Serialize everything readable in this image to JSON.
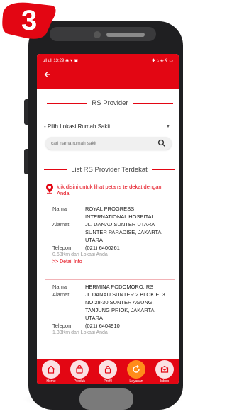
{
  "badge": {
    "number": "3"
  },
  "status": {
    "left": "ull ull 13:29 ◉ ♥ ▣",
    "right": "✱ ⌂ ◈ ⚲ ▭"
  },
  "header": {
    "back_icon": "arrow-left-icon"
  },
  "provider_heading": "RS Provider",
  "location_select": {
    "value": "- Pilih Lokasi Rumah Sakit"
  },
  "search": {
    "placeholder": "cari nama rumah sakit",
    "icon": "search-icon"
  },
  "list_heading": "List RS Provider Terdekat",
  "map_link": {
    "text": "klik disini untuk lihat peta rs terdekat dengan Anda",
    "icon": "location-pin-icon"
  },
  "labels": {
    "name": "Nama",
    "address": "Alamat",
    "phone": "Telepon"
  },
  "providers": [
    {
      "name": "ROYAL PROGRESS INTERNATIONAL HOSPITAL",
      "address": "JL. DANAU SUNTER UTARA SUNTER PARADISE, JAKARTA UTARA",
      "phone": "(021) 6400261",
      "distance": "0.68Km dari Lokasi Anda",
      "detail": ">> Detail Info"
    },
    {
      "name": "HERMINA PODOMORO, RS",
      "address": "JL DANAU SUNTER 2 BLOK E, 3 NO 28-30 SUNTER AGUNG, TANJUNG PRIOK, JAKARTA UTARA",
      "phone": "(021) 6404910",
      "distance": "1.33Km dari Lokasi Anda"
    }
  ],
  "bottom_nav": [
    {
      "label": "Home",
      "icon": "home-icon"
    },
    {
      "label": "Produk",
      "icon": "bag-icon"
    },
    {
      "label": "Profil",
      "icon": "lock-icon"
    },
    {
      "label": "Layanan",
      "icon": "refresh-icon",
      "active": true
    },
    {
      "label": "Inbox",
      "icon": "inbox-icon"
    }
  ],
  "colors": {
    "brand": "#e30613",
    "active_nav": "#ff8c1a"
  }
}
